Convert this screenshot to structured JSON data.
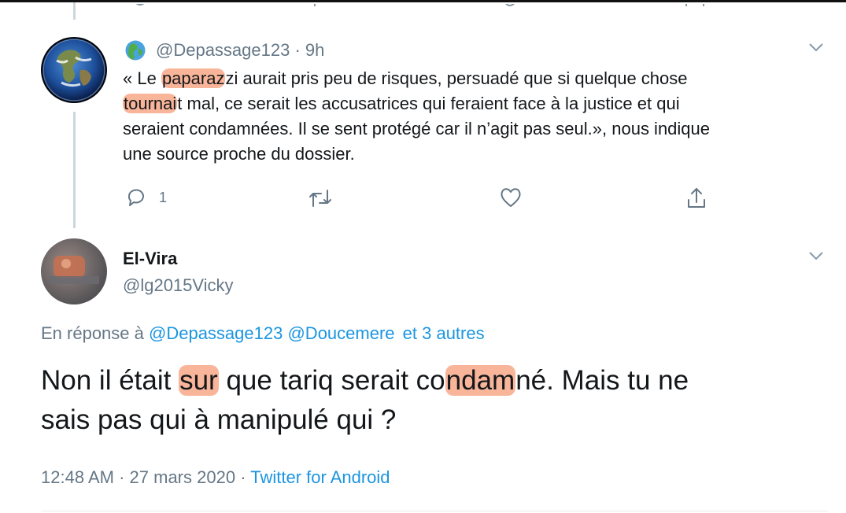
{
  "tweet1": {
    "handle": "@Depassage123",
    "separator": "·",
    "time": "9h",
    "text_parts": [
      "« Le ",
      "paparaz",
      "zi aurait pris peu de risques, persuadé que si quelque chose",
      "tournai",
      "t mal, ce serait les accusatrices qui feraient face à la justice et qui",
      "seraient condamnées. Il se sent protégé car il n’agit pas seul.», nous indique",
      "une source proche du dossier."
    ],
    "reply_count": "1",
    "icons": {
      "verified_globe": "globe-icon",
      "reply": "reply-icon",
      "retweet": "retweet-icon",
      "like": "heart-icon",
      "share": "share-icon",
      "more": "chevron-down-icon"
    }
  },
  "tweet2": {
    "name": "El-Vira",
    "handle": "@lg2015Vicky",
    "reply_prefix": "En réponse à",
    "reply_to": [
      "@Depassage123",
      "@Doucemere",
      "et 3 autres"
    ],
    "text_parts": [
      "Non il était ",
      "sur",
      " que tariq serait co",
      "ndam",
      "né. Mais tu ne",
      "sais pas qui à manipulé qui ?"
    ],
    "time": "12:48 AM",
    "separator": "·",
    "date": "27 mars 2020",
    "source": "Twitter for Android"
  },
  "colors": {
    "text": "#14171a",
    "muted": "#657786",
    "link": "#1b95e0",
    "highlight": "#f6a078",
    "divider": "#e6ecf0"
  }
}
